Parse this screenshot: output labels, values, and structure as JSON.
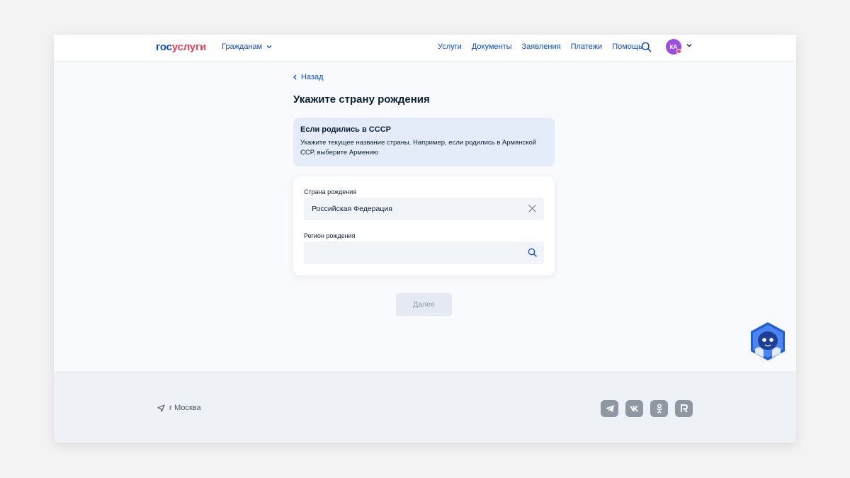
{
  "header": {
    "logo_part1": "гос",
    "logo_part2": "услуги",
    "citizens_label": "Гражданам",
    "nav": [
      "Услуги",
      "Документы",
      "Заявления",
      "Платежи",
      "Помощь"
    ],
    "avatar_initials": "КА"
  },
  "main": {
    "back_label": "Назад",
    "title": "Укажите страну рождения",
    "info": {
      "title": "Если родились в СССР",
      "text": "Укажите текущее название страны. Например, если родились в Армянской ССР, выберите Армению"
    },
    "country_field": {
      "label": "Страна рождения",
      "value": "Российская Федерация"
    },
    "region_field": {
      "label": "Регион рождения",
      "value": ""
    },
    "next_button": "Далее"
  },
  "footer": {
    "city": "г Москва",
    "socials": [
      "telegram",
      "vk",
      "odnoklassniki",
      "rutube"
    ]
  },
  "colors": {
    "accent": "#0d4cd3",
    "brand_red": "#ee3f58",
    "avatar": "#9d4ee2",
    "info_bg": "#e4ecfa"
  }
}
